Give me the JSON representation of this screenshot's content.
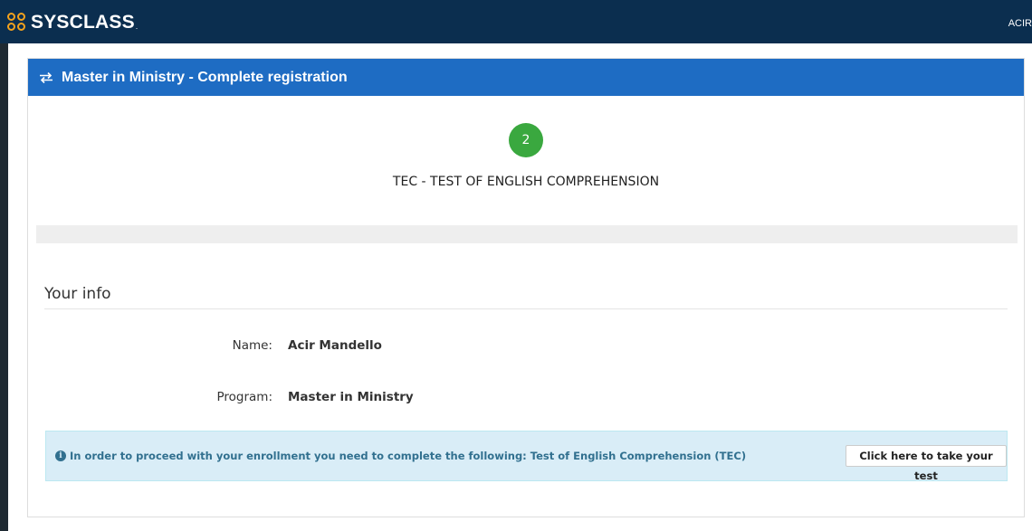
{
  "topbar": {
    "logo_text": "SYSCLASS",
    "logo_dot": ".",
    "user_short": "ACIR"
  },
  "panel": {
    "title": "Master in Ministry - Complete registration",
    "header_icon": "swap-arrows-icon"
  },
  "step": {
    "number": "2",
    "title": "TEC - TEST OF ENGLISH COMPREHENSION",
    "color": "#3aa83f"
  },
  "your_info": {
    "heading": "Your info",
    "rows": [
      {
        "label": "Name:",
        "value": "Acir Mandello"
      },
      {
        "label": "Program:",
        "value": "Master in Ministry"
      }
    ]
  },
  "alert": {
    "icon": "info-circle-icon",
    "message": "In order to proceed with your enrollment you need to complete the following: Test of English Comprehension (TEC)",
    "button_label": "Click here to take your test"
  },
  "colors": {
    "topbar": "#0b2e4f",
    "panel_header": "#1e6cc3",
    "logo_accent": "#f4a21d",
    "alert_bg": "#d9edf7",
    "alert_text": "#31708f"
  }
}
